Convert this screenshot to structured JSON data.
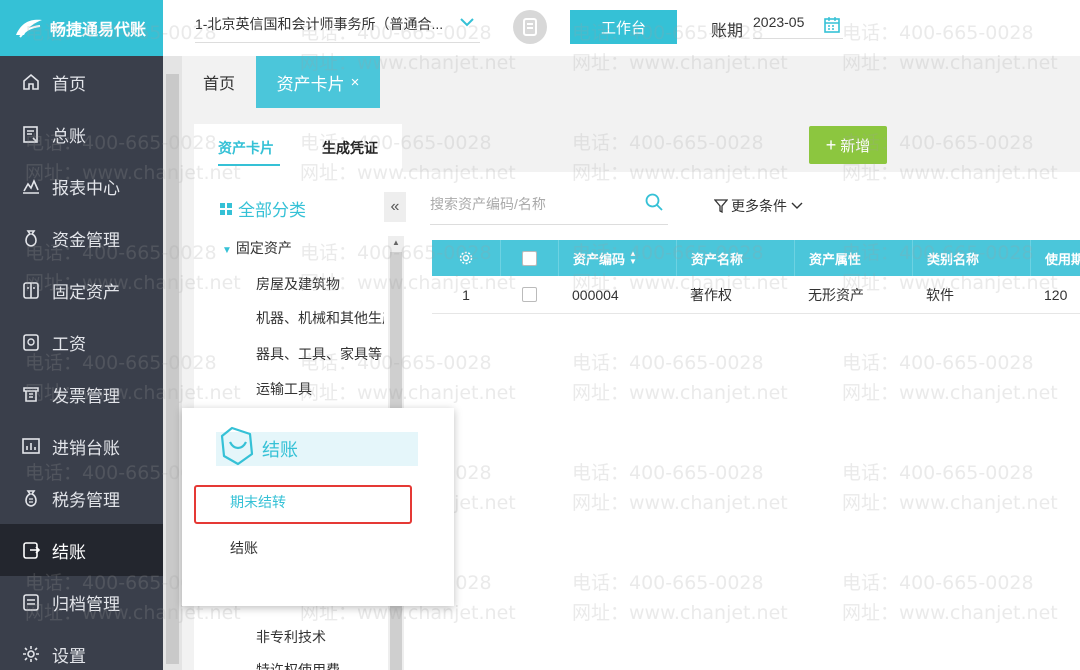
{
  "sidebar": {
    "brand": "畅捷通易代账",
    "items": [
      {
        "label": "首页",
        "icon": "home-icon"
      },
      {
        "label": "总账",
        "icon": "ledger-icon"
      },
      {
        "label": "报表中心",
        "icon": "chart-icon"
      },
      {
        "label": "资金管理",
        "icon": "money-bag-icon"
      },
      {
        "label": "固定资产",
        "icon": "asset-icon"
      },
      {
        "label": "工资",
        "icon": "salary-icon"
      },
      {
        "label": "发票管理",
        "icon": "invoice-icon"
      },
      {
        "label": "进销台账",
        "icon": "inventory-icon"
      },
      {
        "label": "税务管理",
        "icon": "tax-icon"
      },
      {
        "label": "结账",
        "icon": "checkout-icon"
      },
      {
        "label": "归档管理",
        "icon": "archive-icon"
      },
      {
        "label": "设置",
        "icon": "gear-icon"
      }
    ],
    "active_index": 9
  },
  "topbar": {
    "company": "1-北京英信国和会计师事务所（普通合...",
    "workbench": "工作台",
    "period_label": "账期",
    "period_value": "2023-05"
  },
  "tabs": {
    "home": "首页",
    "asset_card": "资产卡片",
    "close": "×"
  },
  "subtabs": {
    "asset_card": "资产卡片",
    "generate_voucher": "生成凭证"
  },
  "categories": {
    "header": "全部分类",
    "root": "固定资产",
    "items": [
      "房屋及建筑物",
      "机器、机械和其他生产设备",
      "器具、工具、家具等",
      "运输工具",
      "非专利技术",
      "特许权使用费"
    ]
  },
  "toolbar": {
    "search_placeholder": "搜索资产编码/名称",
    "more_filters": "更多条件",
    "add": "新增"
  },
  "table": {
    "headers": [
      "资产编码",
      "资产名称",
      "资产属性",
      "类别名称",
      "使用期"
    ],
    "rows": [
      {
        "index": "1",
        "code": "000004",
        "name": "著作权",
        "attribute": "无形资产",
        "category": "软件",
        "life": "120"
      }
    ]
  },
  "popup": {
    "title": "结账",
    "items": [
      "期末结转",
      "结账"
    ]
  },
  "watermark": {
    "phone": "电话：400-665-0028",
    "site": "网址：www.chanjet.net"
  },
  "colors": {
    "accent": "#35c1d6",
    "sidebar": "#3a3f4b",
    "add_button": "#8cc63f",
    "highlight": "#e53935"
  }
}
